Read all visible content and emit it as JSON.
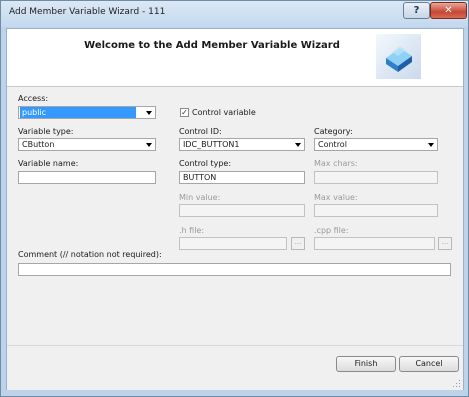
{
  "window": {
    "title": "Add Member Variable Wizard - 111"
  },
  "titlebar": {
    "help_label": "?",
    "close_label": "✕"
  },
  "header": {
    "title": "Welcome to the Add Member Variable Wizard",
    "logo_icon": "wizard-cube-icon"
  },
  "form": {
    "access": {
      "label": "Access:",
      "value": "public"
    },
    "control_variable": {
      "label": "Control variable",
      "checked": true,
      "check_glyph": "✓"
    },
    "variable_type": {
      "label": "Variable type:",
      "value": "CButton"
    },
    "control_id": {
      "label": "Control ID:",
      "value": "IDC_BUTTON1"
    },
    "category": {
      "label": "Category:",
      "value": "Control"
    },
    "variable_name": {
      "label": "Variable name:",
      "value": ""
    },
    "control_type": {
      "label": "Control type:",
      "value": "BUTTON"
    },
    "max_chars": {
      "label": "Max chars:",
      "value": ""
    },
    "min_value": {
      "label": "Min value:",
      "value": ""
    },
    "max_value": {
      "label": "Max value:",
      "value": ""
    },
    "h_file": {
      "label": ".h file:",
      "value": "",
      "browse_label": "..."
    },
    "cpp_file": {
      "label": ".cpp file:",
      "value": "",
      "browse_label": "..."
    },
    "comment": {
      "label": "Comment (// notation not required):",
      "value": ""
    }
  },
  "footer": {
    "finish_label": "Finish",
    "cancel_label": "Cancel"
  },
  "colors": {
    "selection": "#3399ff",
    "close_button": "#c74634",
    "titlebar": "#c3d8ee"
  }
}
